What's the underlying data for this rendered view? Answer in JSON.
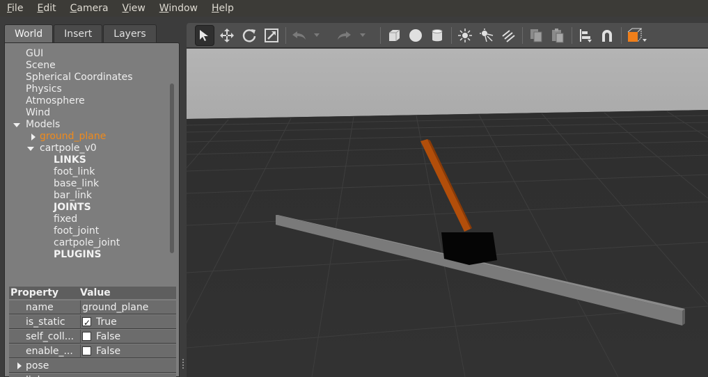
{
  "menu": {
    "items": [
      {
        "label": "File",
        "accel": "F",
        "rest": "ile"
      },
      {
        "label": "Edit",
        "accel": "E",
        "rest": "dit"
      },
      {
        "label": "Camera",
        "accel": "C",
        "rest": "amera"
      },
      {
        "label": "View",
        "accel": "V",
        "rest": "iew"
      },
      {
        "label": "Window",
        "accel": "W",
        "rest": "indow"
      },
      {
        "label": "Help",
        "accel": "H",
        "rest": "elp"
      }
    ]
  },
  "tabs": {
    "world": "World",
    "insert": "Insert",
    "layers": "Layers",
    "active": "World"
  },
  "tree": {
    "gui": "GUI",
    "scene": "Scene",
    "spherical": "Spherical Coordinates",
    "physics": "Physics",
    "atmosphere": "Atmosphere",
    "wind": "Wind",
    "models": "Models",
    "ground_plane": "ground_plane",
    "cartpole": "cartpole_v0",
    "links_header": "LINKS",
    "foot_link": "foot_link",
    "base_link": "base_link",
    "bar_link": "bar_link",
    "joints_header": "JOINTS",
    "fixed": "fixed",
    "foot_joint": "foot_joint",
    "cartpole_joint": "cartpole_joint",
    "plugins_header": "PLUGINS"
  },
  "properties": {
    "header_property": "Property",
    "header_value": "Value",
    "name_label": "name",
    "name_value": "ground_plane",
    "is_static_label": "is_static",
    "is_static_value": "True",
    "is_static_checked": true,
    "self_coll_label": "self_coll...",
    "self_coll_value": "False",
    "self_coll_checked": false,
    "enable_label": "enable_...",
    "enable_value": "False",
    "enable_checked": false,
    "pose_label": "pose",
    "link_label": "link"
  },
  "toolbar": {
    "icons": [
      "select-arrow-icon",
      "translate-icon",
      "rotate-icon",
      "scale-icon",
      "undo-icon",
      "undo-dropdown-icon",
      "redo-icon",
      "redo-dropdown-icon",
      "box-icon",
      "sphere-icon",
      "cylinder-icon",
      "point-light-icon",
      "spot-light-icon",
      "directional-light-icon",
      "copy-icon",
      "paste-icon",
      "align-icon",
      "snap-icon",
      "view-angle-icon"
    ]
  },
  "colors": {
    "accent_orange": "#ef8a1c",
    "pole": "#b24e0a",
    "panel_bg": "#7d7d7d",
    "toolbar_bg": "#4e4e4e",
    "sky": "#b3b3b3",
    "ground": "#303030"
  }
}
